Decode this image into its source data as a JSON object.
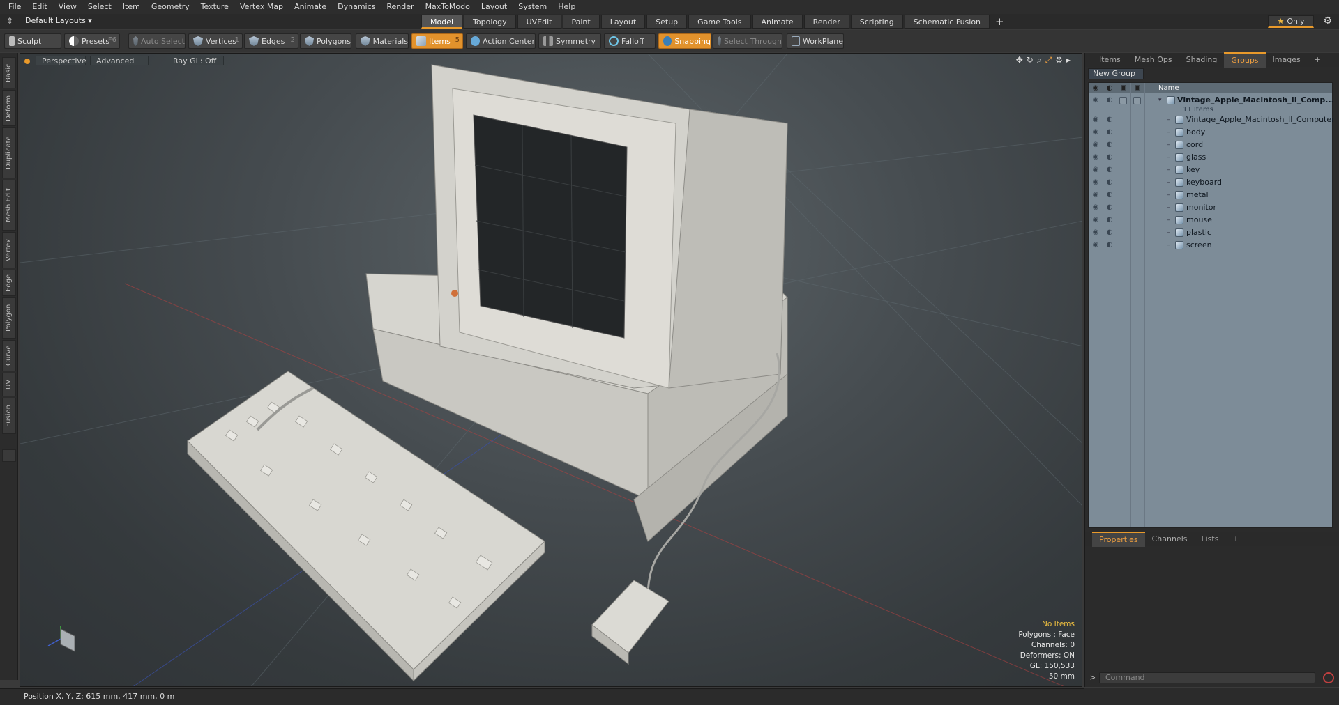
{
  "menu": [
    "File",
    "Edit",
    "View",
    "Select",
    "Item",
    "Geometry",
    "Texture",
    "Vertex Map",
    "Animate",
    "Dynamics",
    "Render",
    "MaxToModo",
    "Layout",
    "System",
    "Help"
  ],
  "layout_selector": "Default Layouts ▾",
  "layout_tabs": [
    "Model",
    "Topology",
    "UVEdit",
    "Paint",
    "Layout",
    "Setup",
    "Game Tools",
    "Animate",
    "Render",
    "Scripting",
    "Schematic Fusion"
  ],
  "active_layout_tab": "Model",
  "only_label": "Only",
  "toolbar": {
    "sculpt": "Sculpt",
    "presets": "Presets",
    "presets_key": "F6",
    "auto_select": "Auto Select",
    "vertices": "Vertices",
    "vertices_count": "1",
    "edges": "Edges",
    "edges_count": "2",
    "polygons": "Polygons",
    "materials": "Materials",
    "items": "Items",
    "items_count": "5",
    "action_center": "Action Center",
    "symmetry": "Symmetry",
    "falloff": "Falloff",
    "snapping": "Snapping",
    "select_through": "Select Through",
    "workplane": "WorkPlane"
  },
  "left_tabs": [
    "Basic",
    "Deform",
    "Duplicate",
    "Mesh Edit",
    "Vertex",
    "Edge",
    "Polygon",
    "Curve",
    "UV",
    "Fusion"
  ],
  "viewport": {
    "view": "Perspective",
    "shading": "Advanced",
    "raygl": "Ray GL: Off",
    "hud": {
      "no_items": "No Items",
      "polygons": "Polygons : Face",
      "channels": "Channels: 0",
      "deformers": "Deformers: ON",
      "gl": "GL: 150,533",
      "scale": "50 mm"
    }
  },
  "panel": {
    "tabs": [
      "Items",
      "Mesh Ops",
      "Shading",
      "Groups",
      "Images"
    ],
    "active_tab": "Groups",
    "new_group": "New Group",
    "name_header": "Name",
    "root": "Vintage_Apple_Macintosh_II_Comp...",
    "root_count": "11 Items",
    "children": [
      "Vintage_Apple_Macintosh_II_Computer",
      "body",
      "cord",
      "glass",
      "key",
      "keyboard",
      "metal",
      "monitor",
      "mouse",
      "plastic",
      "screen"
    ],
    "bottom_tabs": [
      "Properties",
      "Channels",
      "Lists"
    ],
    "active_bottom_tab": "Properties",
    "command_placeholder": "Command"
  },
  "status": "Position X, Y, Z:   615 mm, 417 mm, 0 m",
  "colors": {
    "accent": "#e99a2b",
    "panel_list": "#7d8c98"
  }
}
